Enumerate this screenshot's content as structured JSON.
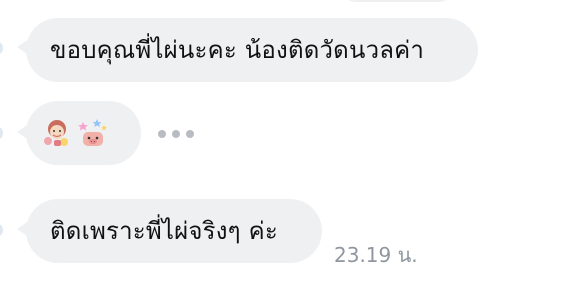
{
  "messages": {
    "message_1": "ขอบคุณพี่ไผ่นะคะ น้องติดวัดนวลค่า",
    "message_2": "ติดเพราะพี่ไผ่จริงๆ ค่ะ"
  },
  "footer": {
    "timestamp": "23.19 น."
  },
  "stickers": {
    "count": 2
  }
}
